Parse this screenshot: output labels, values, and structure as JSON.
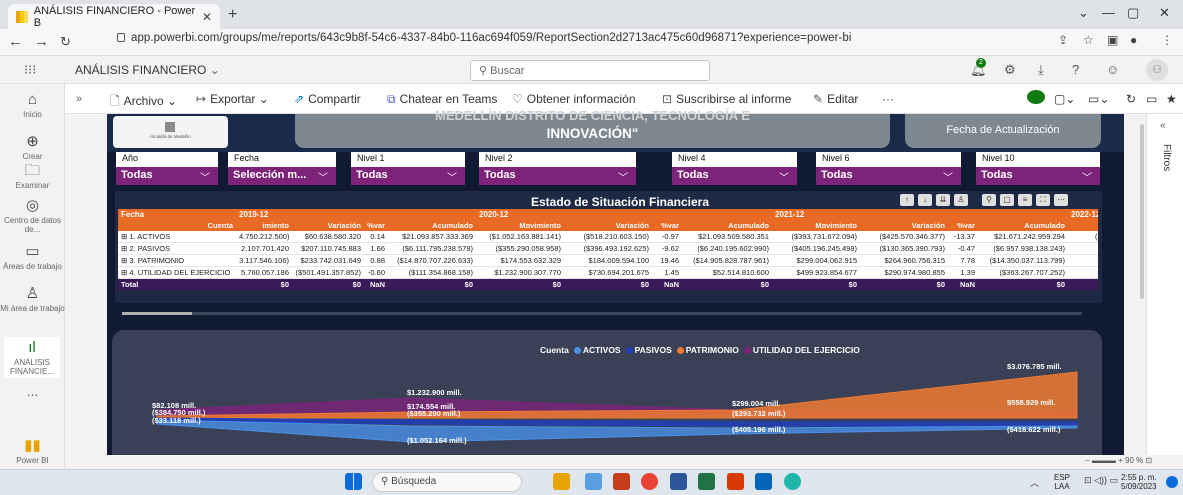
{
  "browser": {
    "tab_title": "ANÁLISIS FINANCIERO - Power B",
    "url": "app.powerbi.com/groups/me/reports/643c9b8f-54c6-4337-84b0-116ac694f059/ReportSection2d2713ac475c60d96871?experience=power-bi"
  },
  "pbi": {
    "report_name": "ANÁLISIS FINANCIERO",
    "search_placeholder": "Buscar",
    "notif_count": "2"
  },
  "leftnav": [
    {
      "label": "Inicio",
      "icon": "⌂"
    },
    {
      "label": "Crear",
      "icon": "⊕"
    },
    {
      "label": "Examinar",
      "icon": "🗀"
    },
    {
      "label": "Centro de datos de...",
      "icon": "◎"
    },
    {
      "label": "Áreas de trabajo",
      "icon": "▭"
    },
    {
      "label": "Mi área de trabajo",
      "icon": "♙"
    },
    {
      "label": "ANÁLISIS FINANCIE...",
      "icon": "ıl"
    },
    {
      "label": "...",
      "icon": ""
    },
    {
      "label": "Power BI",
      "icon": ""
    }
  ],
  "toolbar": {
    "archivo": "Archivo",
    "exportar": "Exportar",
    "compartir": "Compartir",
    "chatear": "Chatear en Teams",
    "obtener": "Obtener información",
    "suscribirse": "Suscribirse al informe",
    "editar": "Editar",
    "more": "···"
  },
  "banner": {
    "title_line1": "MEDELLÍN DISTRITO DE CIENCIA, TECNOLOGÍA E",
    "title_line2": "INNOVACIÓN\"",
    "update_label": "Fecha de Actualización",
    "logo_text": "Alcaldía de Medellín"
  },
  "slicers": [
    {
      "label": "Año",
      "value": "Todas"
    },
    {
      "label": "Fecha",
      "value": "Selección m..."
    },
    {
      "label": "Nivel 1",
      "value": "Todas"
    },
    {
      "label": "Nivel 2",
      "value": "Todas"
    },
    {
      "label": "Nivel 4",
      "value": "Todas"
    },
    {
      "label": "Nivel 6",
      "value": "Todas"
    },
    {
      "label": "Nivel 10",
      "value": "Todas"
    }
  ],
  "table": {
    "title": "Estado de Situación Financiera",
    "header1": [
      "Fecha",
      "2019-12",
      "",
      "",
      "",
      "2020-12",
      "",
      "",
      "",
      "2021-12",
      "",
      "",
      "",
      "2022-12"
    ],
    "header2": [
      "Cuenta",
      "imiento",
      "Variación",
      "%var",
      "Acumulado",
      "Movimiento",
      "Variación",
      "%var",
      "Acumulado",
      "Movimiento",
      "Variación",
      "%var",
      "Acumulado",
      "Movimient"
    ],
    "rows": [
      [
        "⊞ 1. ACTIVOS",
        "4.750.212.500)",
        "$60.638.580.320",
        "0.14",
        "$21.093.857.333.369",
        "($1.052.163.881.141)",
        "($518.210.603.150)",
        "-0.97",
        "$21.093.509.580.351",
        "($393.731.672.094)",
        "($425.570.346.377)",
        "-13.37",
        "$21.671.242.959.294",
        "($3.217.091"
      ],
      [
        "⊞ 2. PASIVOS",
        "2.107.701.420",
        "$207.110.745.883",
        "1.66",
        "($6.111.795.238.578)",
        "($355.290.058.958)",
        "($396.493.192.625)",
        "-9.62",
        "($6.240.195.602.990)",
        "($405.196.245.498)",
        "($130.365.390.793)",
        "-0.47",
        "($6.957.938.138.243)",
        "($418.622"
      ],
      [
        "⊞ 3. PATRIMONIO",
        "3.117.546.106)",
        "$233.742.031.649",
        "0.88",
        "($14.870.707.226.633)",
        "$174.553.632.329",
        "$184.009.594.100",
        "19.46",
        "($14.905.828.787.961)",
        "$299.004.062.915",
        "$264.960.756.315",
        "7.78",
        "($14.350.037.113.799)",
        "$3.076.785"
      ],
      [
        "⊞ 4. UTILIDAD DEL EJERCICIO",
        "5.760.057.186",
        "($501.491.357.852)",
        "-0.60",
        "($111.354.868.158)",
        "$1.232.900.307.770",
        "$730.694.201.675",
        "1.45",
        "$52.514.810.600",
        "$499.923.854.677",
        "$290.974.980.855",
        "1.39",
        "($363.267.707.252)",
        "$558.928"
      ]
    ],
    "total": [
      "Total",
      "$0",
      "$0",
      "NaN",
      "$0",
      "$0",
      "$0",
      "NaN",
      "$0",
      "$0",
      "$0",
      "NaN",
      "$0",
      "$0"
    ]
  },
  "chart": {
    "legend_title": "Cuenta",
    "series": [
      {
        "name": "ACTIVOS",
        "color": "#4a90e8"
      },
      {
        "name": "PASIVOS",
        "color": "#1f3fbf"
      },
      {
        "name": "PATRIMONIO",
        "color": "#f07a30"
      },
      {
        "name": "UTILIDAD DEL EJERCICIO",
        "color": "#7d237a"
      }
    ],
    "labels": [
      {
        "text": "$82.108 mill.",
        "series": "UTILIDAD DEL EJERCICIO"
      },
      {
        "text": "($384.750 mill.)",
        "series": "PASIVOS"
      },
      {
        "text": "($33.118 mill.)",
        "series": "ACTIVOS"
      },
      {
        "text": "$1.232.900 mill.",
        "series": "UTILIDAD DEL EJERCICIO"
      },
      {
        "text": "$174.554 mill.",
        "series": "PATRIMONIO"
      },
      {
        "text": "($355.290 mill.)",
        "series": "PASIVOS"
      },
      {
        "text": "($1.052.164 mill.)",
        "series": "ACTIVOS"
      },
      {
        "text": "$299.004 mill.",
        "series": "PATRIMONIO"
      },
      {
        "text": "($393.732 mill.)",
        "series": "ACTIVOS"
      },
      {
        "text": "($405.196 mill.)",
        "series": "PASIVOS"
      },
      {
        "text": "$3.076.785 mill.",
        "series": "PATRIMONIO"
      },
      {
        "text": "$558.929 mill.",
        "series": "UTILIDAD DEL EJERCICIO"
      },
      {
        "text": "($418.622 mill.)",
        "series": "PASIVOS"
      }
    ]
  },
  "filters_label": "Filtros",
  "zoom": "90 %",
  "taskbar": {
    "search": "Búsqueda",
    "lang1": "ESP",
    "lang2": "LAA",
    "time": "2:55 p. m.",
    "date": "5/09/2023"
  }
}
